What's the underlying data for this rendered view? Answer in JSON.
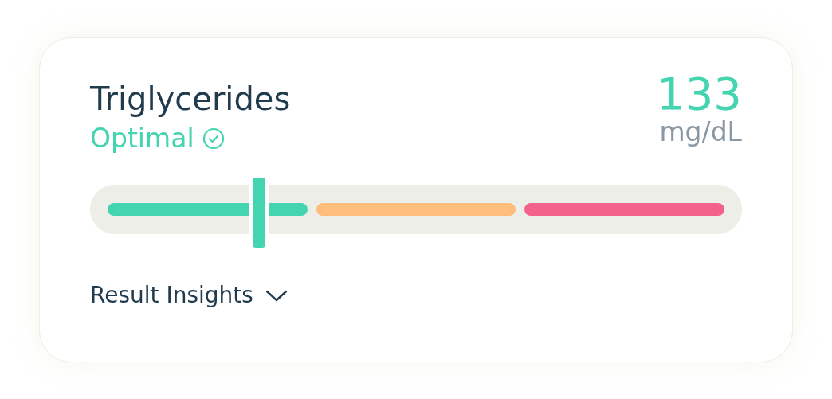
{
  "title": "Triglycerides",
  "status": {
    "label": "Optimal",
    "color": "#45d4b0"
  },
  "value": "133",
  "unit": "mg/dL",
  "range": {
    "level": 0.245,
    "segments": [
      {
        "color": "#45d4b0"
      },
      {
        "color": "#fdbd7b"
      },
      {
        "color": "#f2628a"
      }
    ]
  },
  "insights": {
    "label": "Result Insights",
    "expanded": false
  }
}
